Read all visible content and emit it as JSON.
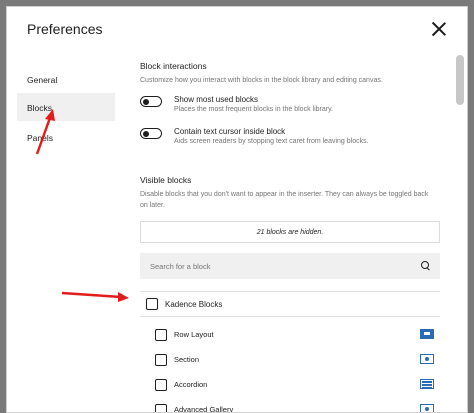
{
  "dialog": {
    "title": "Preferences",
    "close_label": "Close"
  },
  "sidebar": {
    "items": [
      {
        "label": "General"
      },
      {
        "label": "Blocks"
      },
      {
        "label": "Panels"
      }
    ],
    "active_index": 1
  },
  "block_interactions": {
    "title": "Block interactions",
    "description": "Customize how you interact with blocks in the block library and editing canvas.",
    "toggles": [
      {
        "label": "Show most used blocks",
        "description": "Places the most frequent blocks in the block library.",
        "enabled": false
      },
      {
        "label": "Contain text cursor inside block",
        "description": "Aids screen readers by stopping text caret from leaving blocks.",
        "enabled": false
      }
    ]
  },
  "visible_blocks": {
    "title": "Visible blocks",
    "description": "Disable blocks that you don't want to appear in the inserter. They can always be toggled back on later.",
    "hidden_count_text": "21 blocks are hidden.",
    "search_placeholder": "Search for a block",
    "category": {
      "label": "Kadence Blocks",
      "checked": false
    },
    "blocks": [
      {
        "label": "Row Layout",
        "checked": false,
        "icon": "row-layout-icon"
      },
      {
        "label": "Section",
        "checked": false,
        "icon": "section-icon"
      },
      {
        "label": "Accordion",
        "checked": false,
        "icon": "accordion-icon"
      },
      {
        "label": "Advanced Gallery",
        "checked": false,
        "icon": "gallery-icon"
      }
    ]
  },
  "colors": {
    "annotation_arrow": "#e21b1b",
    "block_icon": "#2b6bb5",
    "active_sidebar_bg": "#f0f0f0"
  }
}
